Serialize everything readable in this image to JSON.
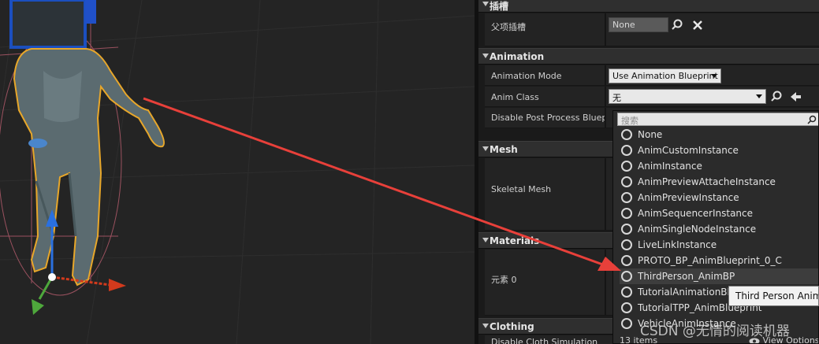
{
  "categories": {
    "socket": {
      "title": "插槽"
    },
    "animation": {
      "title": "Animation"
    },
    "mesh": {
      "title": "Mesh"
    },
    "materials": {
      "title": "Materials"
    },
    "clothing": {
      "title": "Clothing"
    }
  },
  "properties": {
    "parent_socket": {
      "label": "父项插槽",
      "value": "None"
    },
    "animation_mode": {
      "label": "Animation Mode",
      "value": "Use Animation Blueprint"
    },
    "anim_class": {
      "label": "Anim Class",
      "value": "无"
    },
    "disable_post_process": {
      "label": "Disable Post Process Bluepri"
    },
    "skeletal_mesh": {
      "label": "Skeletal Mesh"
    },
    "element0": {
      "label": "元素 0"
    },
    "disable_cloth": {
      "label": "Disable Cloth Simulation"
    }
  },
  "popup": {
    "search_placeholder": "搜索",
    "options": [
      "None",
      "AnimCustomInstance",
      "AnimInstance",
      "AnimPreviewAttacheInstance",
      "AnimPreviewInstance",
      "AnimSequencerInstance",
      "AnimSingleNodeInstance",
      "LiveLinkInstance",
      "PROTO_BP_AnimBlueprint_0_C",
      "ThirdPerson_AnimBP",
      "TutorialAnimationBlueprint",
      "TutorialTPP_AnimBlueprint",
      "VehicleAnimInstance"
    ],
    "hovered_index": 9,
    "item_count": "13 items",
    "view_options": "View Options"
  },
  "tooltip": {
    "text": "Third Person Anim BP"
  },
  "watermark": {
    "text": "CSDN @无情的阅读机器"
  },
  "colors": {
    "annotation_arrow": "#e8403a",
    "selection_outline": "#e8a72a",
    "gizmo_x": "#d23a1c",
    "gizmo_y": "#4ea83c",
    "gizmo_z": "#2a70e0"
  }
}
